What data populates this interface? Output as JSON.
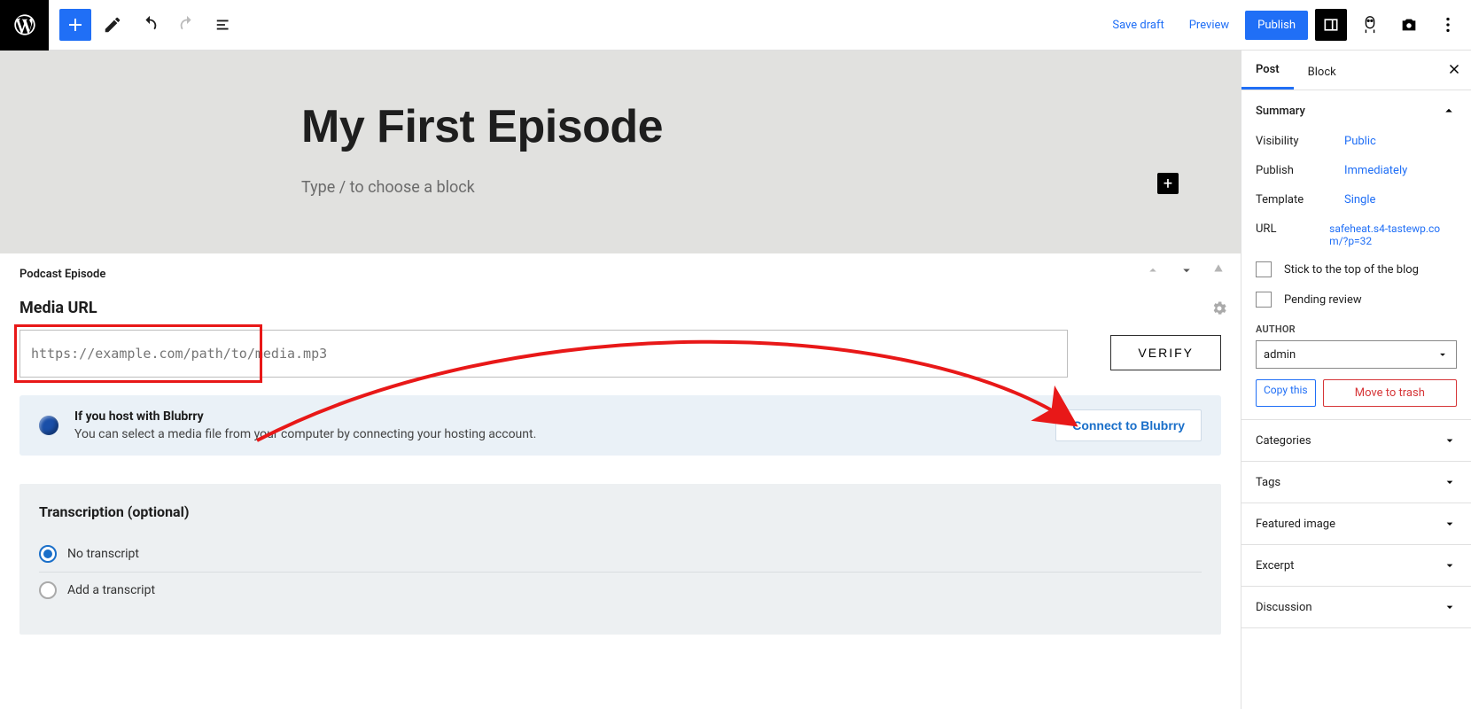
{
  "topbar": {
    "save_draft": "Save draft",
    "preview": "Preview",
    "publish": "Publish"
  },
  "hero": {
    "title": "My First Episode",
    "placeholder": "Type / to choose a block"
  },
  "podcast": {
    "panel_label": "Podcast Episode",
    "media_url_label": "Media URL",
    "url_placeholder": "https://example.com/path/to/media.mp3",
    "verify": "VERIFY",
    "blubrry": {
      "heading": "If you host with Blubrry",
      "sub": "You can select a media file from your computer by connecting your hosting account.",
      "connect": "Connect to Blubrry"
    },
    "transcription": {
      "heading": "Transcription (optional)",
      "opt_none": "No transcript",
      "opt_add": "Add a transcript"
    }
  },
  "sidebar": {
    "tabs": {
      "post": "Post",
      "block": "Block"
    },
    "summary": {
      "label": "Summary",
      "visibility_k": "Visibility",
      "visibility_v": "Public",
      "publish_k": "Publish",
      "publish_v": "Immediately",
      "template_k": "Template",
      "template_v": "Single",
      "url_k": "URL",
      "url_v": "safeheat.s4-tastewp.com/?p=32",
      "stick": "Stick to the top of the blog",
      "pending": "Pending review",
      "author_label": "AUTHOR",
      "author_value": "admin",
      "copy": "Copy this",
      "trash": "Move to trash"
    },
    "sections": {
      "categories": "Categories",
      "tags": "Tags",
      "featured": "Featured image",
      "excerpt": "Excerpt",
      "discussion": "Discussion"
    }
  }
}
